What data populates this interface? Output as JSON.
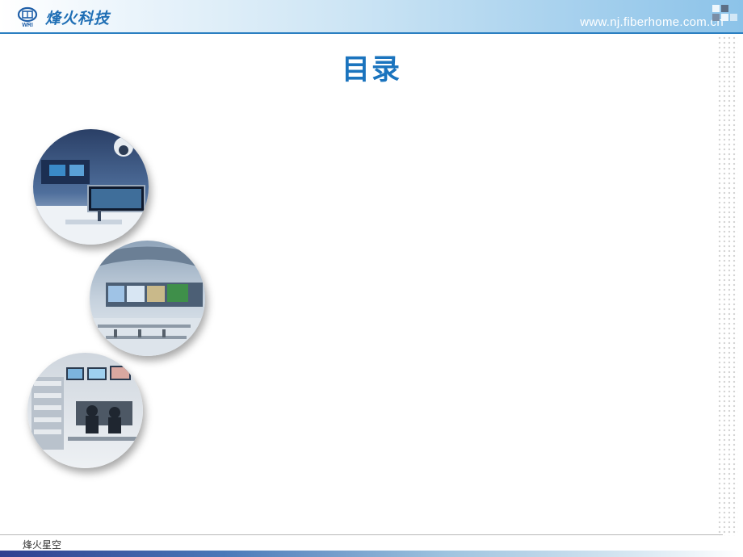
{
  "header": {
    "logo_text": "烽火科技",
    "logo_sub": "WRI",
    "url": "www.nj.fiberhome.com.cn"
  },
  "slide": {
    "title": "目录"
  },
  "images": [
    {
      "name": "surveillance-room-photo"
    },
    {
      "name": "control-center-photo"
    },
    {
      "name": "operations-room-photo"
    }
  ],
  "footer": {
    "text": "烽火星空"
  },
  "colors": {
    "title": "#1b74be",
    "header_line": "#2b7fc1",
    "logo": "#1f6fb5"
  }
}
